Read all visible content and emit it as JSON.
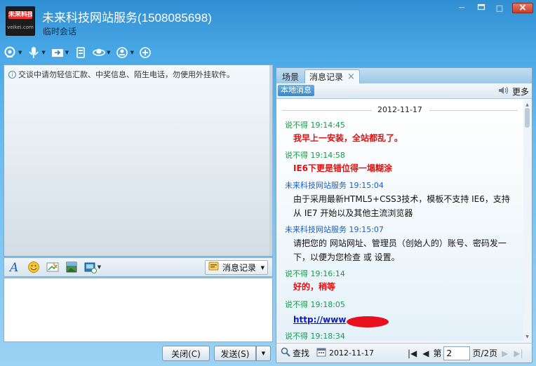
{
  "window": {
    "contact_name": "未来科技网站服务(1508085698)",
    "contact_status": "临时会话",
    "avatar_logo_text": "未来科技",
    "avatar_logo_sub": "veikei.com",
    "buttons": {
      "minimize": "—",
      "maximize": "□",
      "close": "×"
    }
  },
  "toolbar": {
    "items": [
      {
        "icon": "video-call-icon"
      },
      {
        "icon": "microphone-icon"
      },
      {
        "icon": "file-transfer-icon"
      },
      {
        "icon": "remote-assist-icon"
      },
      {
        "icon": "app-center-icon"
      },
      {
        "icon": "add-contact-icon"
      },
      {
        "icon": "invite-icon"
      }
    ]
  },
  "left": {
    "notice": "交谈中请勿轻信汇款、中奖信息、陌生电话，勿使用外挂软件。"
  },
  "format_bar": {
    "history_toggle": "消息记录"
  },
  "buttons": {
    "close": "关闭(C)",
    "send": "发送(S)"
  },
  "right": {
    "tabs": {
      "scene": "场景",
      "history": "消息记录"
    },
    "local_tab": "本地消息",
    "more": "更多",
    "date": "2012-11-17",
    "messages": [
      {
        "sender": "说不得",
        "time": "19:14:45",
        "who": "them",
        "text": "我早上一安装，全站都乱了。",
        "style": "red"
      },
      {
        "sender": "说不得",
        "time": "19:14:58",
        "who": "them",
        "text": "IE6下更是错位得一塌糊涂",
        "style": "red"
      },
      {
        "sender": "未来科技网站服务",
        "time": "19:15:04",
        "who": "me",
        "text": "由于采用最新HTML5+CSS3技术，模板不支持 IE6，支持从 IE7 开始以及其他主流浏览器",
        "style": "black"
      },
      {
        "sender": "未来科技网站服务",
        "time": "19:15:07",
        "who": "me",
        "text": "请把您的 网站网址、管理员（创始人的）账号、密码发一下，以便为您检查 或 设置。",
        "style": "black"
      },
      {
        "sender": "说不得",
        "time": "19:16:14",
        "who": "them",
        "text": "好的，稍等",
        "style": "red"
      },
      {
        "sender": "说不得",
        "time": "19:18:05",
        "who": "them",
        "text": "http://www",
        "style": "link"
      },
      {
        "sender": "说不得",
        "time": "19:18:34",
        "who": "them",
        "text": "",
        "style": "black"
      }
    ],
    "pager": {
      "search": "查找",
      "date": "2012-11-17",
      "page_prefix": "第",
      "page_value": "2",
      "page_suffix": "页/2页"
    }
  },
  "colors": {
    "window_blue": "#48a8e6",
    "them_name": "#1a9c4a",
    "me_name": "#1a5fc8",
    "highlight_red": "#e01010"
  }
}
